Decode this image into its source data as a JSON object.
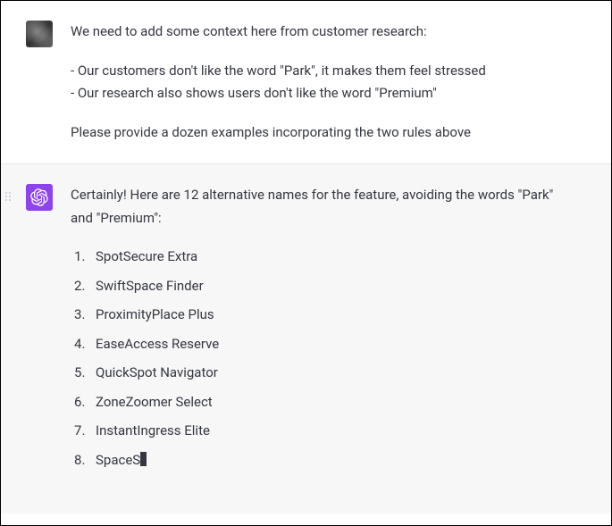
{
  "user_message": {
    "intro": "We need to add some context here from customer research:",
    "point1": "- Our customers don't like the word \"Park\", it makes them feel stressed",
    "point2": "- Our research also shows users don't like the word \"Premium\"",
    "request": "Please provide a dozen examples incorporating the two rules above"
  },
  "assistant_message": {
    "intro": "Certainly! Here are 12 alternative names for the feature, avoiding the words \"Park\" and \"Premium\":",
    "items": [
      "SpotSecure Extra",
      "SwiftSpace Finder",
      "ProximityPlace Plus",
      "EaseAccess Reserve",
      "QuickSpot Navigator",
      "ZoneZoomer Select",
      "InstantIngress Elite",
      "SpaceS"
    ]
  }
}
